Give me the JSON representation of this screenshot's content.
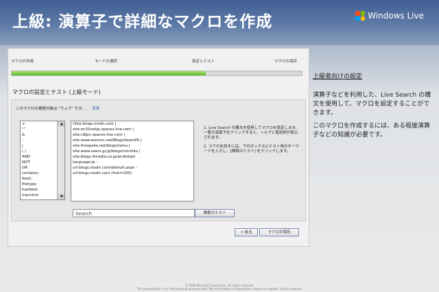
{
  "header": {
    "title": "上級: 演算子で詳細なマクロを作成",
    "brand": "Windows Live",
    "brand_colors": [
      "#f25022",
      "#7fba00",
      "#00a4ef",
      "#ffb900"
    ]
  },
  "wizard": {
    "steps": [
      "マクロの作成",
      "モードの選択",
      "設定とテスト",
      "マクロの保存"
    ],
    "progress": 0.67
  },
  "section_title": "マクロの設定とテスト (上級モード)",
  "target": {
    "label": "このマクロの検索対象は \"ウェブ\" です。",
    "change_link": "変更"
  },
  "operators": [
    "+",
    "\"\"",
    "&",
    "-",
    "|",
    "( )",
    "AND",
    "NOT",
    "OR",
    "contains:",
    "feed:",
    "filetype:",
    "hasfeed:",
    "inanchor:"
  ],
  "macro_lines": [
    "(Site:blogs.msdn.com |",
    "site:on10netjp.spaces.live.com |",
    "site:c9jpn.spaces.live.com |",
    "site:www.exconn.net/Blogs/team05 |",
    "site:thespoke.net/blogs/tatsu |",
    "site:www.users.gr.jp/blogs/michiko |",
    "site:blogs.itmedia.co.jp/andokoji)",
    "language:ja -",
    "url:blogs.msdn.com/default.aspx -",
    "url:blogs.msdn.com (frsh=100)"
  ],
  "help": [
    "1. Live Search の構文を使用してマクロを設定します。一覧の演算子をクリックすると、ヘルプと使用例が表示されます。",
    "2. マクロを試すには、下のボックスにテスト用のキーワードを入力し、[検索のテスト] をクリックします。"
  ],
  "search": {
    "placeholder": "Search",
    "test_button": "検索のテスト"
  },
  "nav": {
    "back": "< 戻る",
    "save": "マクロの保存"
  },
  "sidebar": {
    "heading": "上級者向けの設定",
    "para1": "演算子などを利用した、Live Search の構文を使用して、マクロを設定することができます。",
    "para2": "このマクロを作成するには、ある程度演算子などの知識が必要です。"
  },
  "footer": {
    "copyright": "© 2006 Microsoft Corporation. All rights reserved.",
    "disclaimer": "This presentation is for informational purposes only. Microsoft makes no warranties, express or implied, in this summary."
  }
}
